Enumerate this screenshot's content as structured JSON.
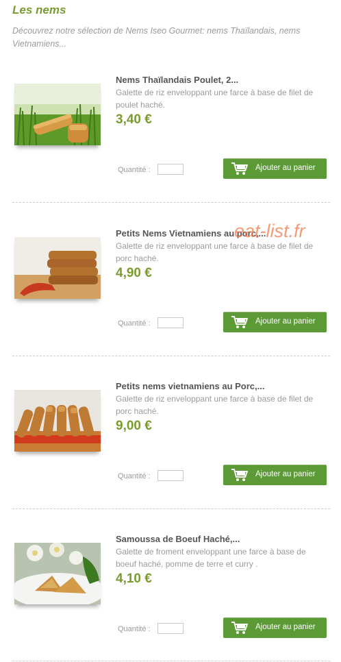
{
  "category": {
    "title": "Les nems",
    "description": "Découvrez notre sélection de Nems Iseo Gourmet: nems Thaïlandais, nems Vietnamiens..."
  },
  "quantity_label": "Quantité :",
  "add_to_cart_label": "Ajouter au panier",
  "watermark": "eat-list.fr",
  "products": [
    {
      "name": "Nems Thaïlandais Poulet, 2...",
      "description": "Galette de riz enveloppant une farce à base de filet de poulet haché.",
      "price": "3,40 €",
      "quantity": ""
    },
    {
      "name": "Petits Nems Vietnamiens au porc,...",
      "description": "Galette de riz enveloppant une farce à base de filet de porc haché.",
      "price": "4,90 €",
      "quantity": ""
    },
    {
      "name": "Petits nems vietnamiens au Porc,...",
      "description": "Galette de riz enveloppant une farce à base de filet de porc haché.",
      "price": "9,00 €",
      "quantity": ""
    },
    {
      "name": "Samoussa de Boeuf Haché,...",
      "description": "Galette de froment enveloppant une farce à base de boeuf haché, pomme de terre et curry .",
      "price": "4,10 €",
      "quantity": ""
    }
  ],
  "colors": {
    "accent_green": "#7a9b2f",
    "button_green": "#5b9a35",
    "text_grey": "#9a9a9a",
    "watermark": "#f07846"
  },
  "icons": {
    "cart": "shopping-cart-icon"
  }
}
